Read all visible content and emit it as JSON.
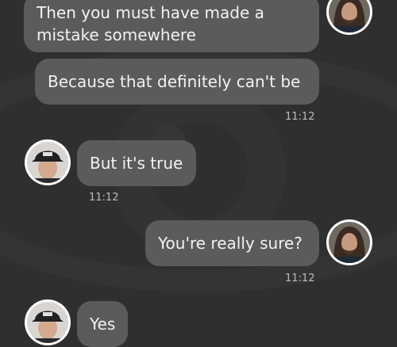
{
  "background": {
    "color": "#2f2f2f",
    "watermark": "eye-icon"
  },
  "messages": [
    {
      "id": "m1",
      "side": "right",
      "text_lines": [
        "Then you must have made a",
        "mistake somewhere"
      ]
    },
    {
      "id": "m2",
      "side": "right",
      "text": "Because that definitely can't be",
      "time": "11:12"
    },
    {
      "id": "m3",
      "side": "left",
      "text": "But it's true",
      "time": "11:12"
    },
    {
      "id": "m4",
      "side": "right",
      "text": "You're really sure?",
      "time": "11:12"
    },
    {
      "id": "m5",
      "side": "left",
      "text": "Yes"
    }
  ],
  "colors": {
    "bubble": "#5b5b5b",
    "text": "#f2f2f2",
    "timestamp": "#bcbcbc",
    "avatar_ring": "#ffffff"
  },
  "avatars": {
    "left": "user-avatar-cap",
    "right": "user-avatar-long-hair"
  }
}
